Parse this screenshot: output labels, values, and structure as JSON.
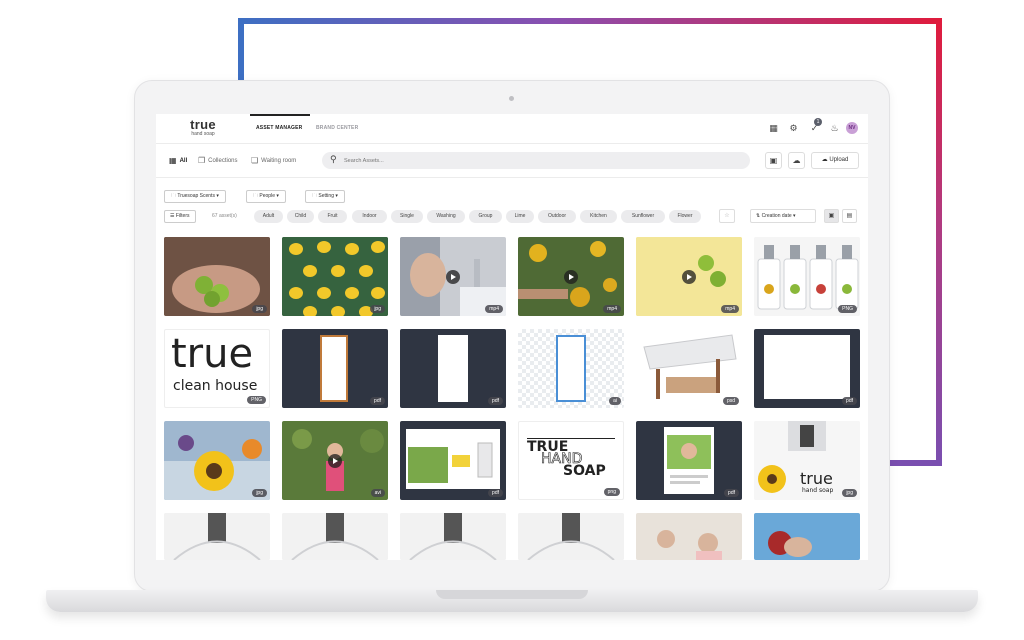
{
  "header": {
    "logo_main": "true",
    "logo_sub": "hand soap",
    "nav": [
      "ASSET MANAGER",
      "BRAND CENTER"
    ],
    "notification_count": "1",
    "avatar_initials": "NV"
  },
  "tabs": [
    {
      "label": "All",
      "icon": "grid-icon"
    },
    {
      "label": "Collections",
      "icon": "collections-icon"
    },
    {
      "label": "Waiting room",
      "icon": "waiting-room-icon"
    }
  ],
  "search": {
    "placeholder": "Search Assets..."
  },
  "upload_label": "Upload",
  "dropdowns": [
    "Truesoap Scents",
    "People",
    "Setting"
  ],
  "filters_label": "Filters",
  "asset_count": "67 asset(s)",
  "chips": [
    "Adult",
    "Child",
    "Fruit",
    "Indoor",
    "Single",
    "Washing",
    "Group",
    "Lime",
    "Outdoor",
    "Kitchen",
    "Sunflower",
    "Flower"
  ],
  "sort_label": "Creation date",
  "grid": [
    {
      "ext": "jpg",
      "video": false
    },
    {
      "ext": "jpg",
      "video": false
    },
    {
      "ext": "mp4",
      "video": true
    },
    {
      "ext": "mp4",
      "video": true
    },
    {
      "ext": "mp4",
      "video": true
    },
    {
      "ext": "PNG",
      "video": false
    },
    {
      "ext": "PNG",
      "video": false
    },
    {
      "ext": "pdf",
      "video": false
    },
    {
      "ext": "pdf",
      "video": false
    },
    {
      "ext": "ai",
      "video": false
    },
    {
      "ext": "psd",
      "video": false
    },
    {
      "ext": "pdf",
      "video": false
    },
    {
      "ext": "jpg",
      "video": false
    },
    {
      "ext": "avi",
      "video": true
    },
    {
      "ext": "pdf",
      "video": false
    },
    {
      "ext": "png",
      "video": false
    },
    {
      "ext": "pdf",
      "video": false
    },
    {
      "ext": "jpg",
      "video": false
    }
  ],
  "tile_text": {
    "true_big": "true",
    "clean_house": "clean house",
    "true_hand_soap_1": "TRUE",
    "true_hand_soap_2": "HAND",
    "true_hand_soap_3": "SOAP",
    "bottle_true": "true",
    "bottle_sub": "hand soap"
  },
  "colors": {
    "accent_frame_start": "#3d6fc3",
    "accent_frame_end": "#e01b3c",
    "dark_tile": "#2f3542"
  }
}
